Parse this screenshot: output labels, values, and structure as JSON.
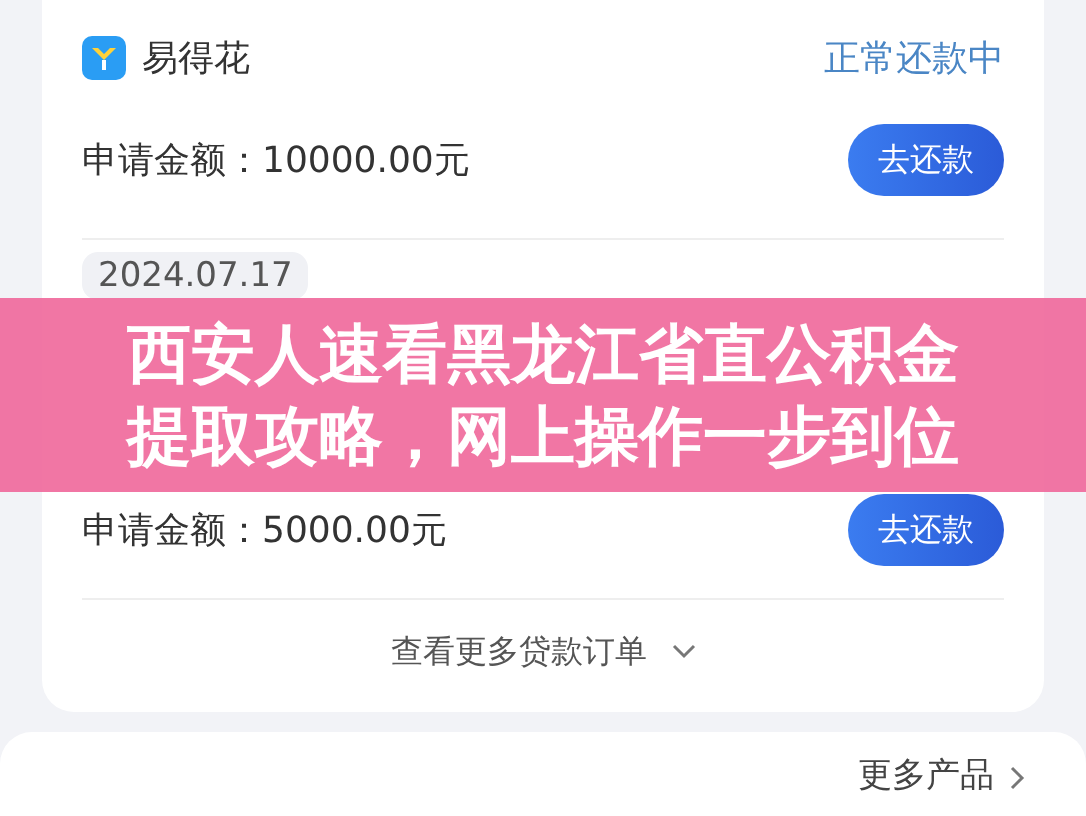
{
  "orders": [
    {
      "product": "易得花",
      "status": "正常还款中",
      "amount": "申请金额：10000.00元",
      "button": "去还款"
    },
    {
      "date": "2024.07.17",
      "amount": "申请金额：5000.00元",
      "button": "去还款"
    }
  ],
  "more_orders": "查看更多贷款订单",
  "banner": {
    "lines": [
      "西安人速看黑龙江省直公积金",
      "提取攻略，网上操作一步到位"
    ]
  },
  "more_products": "更多产品"
}
